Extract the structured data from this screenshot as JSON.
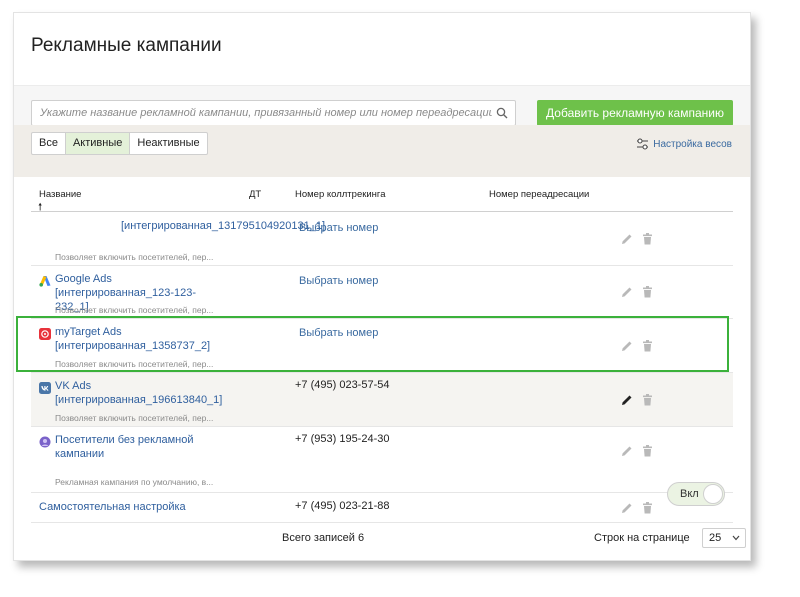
{
  "page": {
    "title": "Рекламные кампании"
  },
  "toolbar": {
    "search_placeholder": "Укажите название рекламной кампании, привязанный номер или номер переадресации",
    "add_label": "Добавить рекламную кампанию"
  },
  "filters": {
    "all": "Все",
    "active": "Активные",
    "inactive": "Неактивные",
    "selected": "active",
    "weights_label": "Настройка весов"
  },
  "table": {
    "headers": {
      "name": "Название",
      "dt": "ДТ",
      "calltracking": "Номер коллтрекинга",
      "redirect": "Номер переадресации"
    },
    "sort_indicator": "🠕",
    "rows": [
      {
        "icon": "none",
        "name": "[интегрированная_131795104920131_1]",
        "desc": "Позволяет включить посетителей, пер...",
        "phone": "Выбрать номер",
        "phone_is_link": true,
        "edit_active": false
      },
      {
        "icon": "google-ads-icon",
        "name": "Google Ads [интегрированная_123-123-232_1]",
        "desc": "Позволяет включить посетителей, пер...",
        "phone": "Выбрать номер",
        "phone_is_link": true,
        "edit_active": false
      },
      {
        "icon": "mytarget-icon",
        "name": "myTarget Ads [интегрированная_1358737_2]",
        "desc": "Позволяет включить посетителей, пер...",
        "phone": "Выбрать номер",
        "phone_is_link": true,
        "edit_active": false
      },
      {
        "icon": "vk-icon",
        "name": "VK Ads [интегрированная_196613840_1]",
        "desc": "Позволяет включить посетителей, пер...",
        "phone": "+7 (495) 023-57-54",
        "phone_is_link": false,
        "edit_active": true
      },
      {
        "icon": "visitors-icon",
        "name": "Посетители без рекламной кампании",
        "desc": "Рекламная кампания по умолчанию, в...",
        "phone": "+7 (953) 195-24-30",
        "phone_is_link": false,
        "edit_active": false
      },
      {
        "icon": "none",
        "name": "Самостоятельная настройка",
        "desc": "",
        "phone": "+7 (495) 023-21-88",
        "phone_is_link": false,
        "edit_active": false,
        "toggle_label": "Вкл"
      }
    ]
  },
  "footer": {
    "total": "Всего записей 6",
    "rows_per_page_label": "Строк на странице",
    "rows_per_page_value": "25"
  },
  "colors": {
    "accent_green": "#6ec14a",
    "link_blue": "#2f5f9e",
    "highlight": "#3bb13b"
  }
}
